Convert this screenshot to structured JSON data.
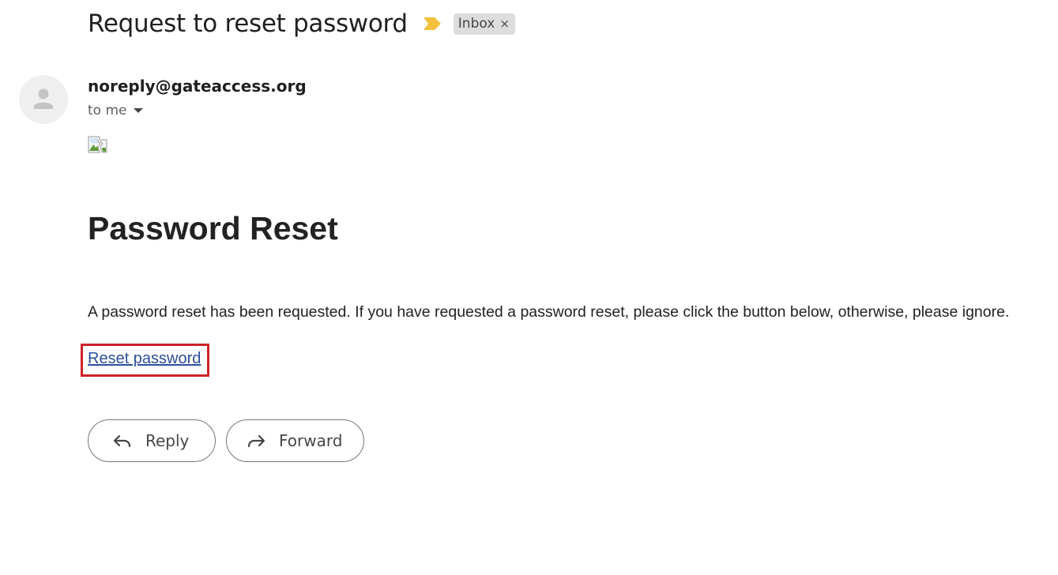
{
  "email": {
    "subject": "Request to reset password",
    "label": "Inbox",
    "label_remove": "×",
    "sender": "noreply@gateaccess.org",
    "recipient_summary": "to me"
  },
  "message": {
    "heading": "Password Reset",
    "body": "A password reset has been requested. If you have requested a password reset, please click the button below, otherwise, please ignore.",
    "link_text": "Reset password"
  },
  "actions": {
    "reply_label": "Reply",
    "forward_label": "Forward"
  },
  "icons": {
    "importance": "important-marker-icon",
    "avatar": "person-icon",
    "caret": "chevron-down-icon",
    "image": "broken-image-icon",
    "reply": "reply-icon",
    "forward": "forward-icon"
  },
  "colors": {
    "importance_marker": "#f2c13f",
    "link": "#2b4e9d",
    "highlight_box": "#d0212a",
    "label_chip_bg": "#dddddd"
  }
}
